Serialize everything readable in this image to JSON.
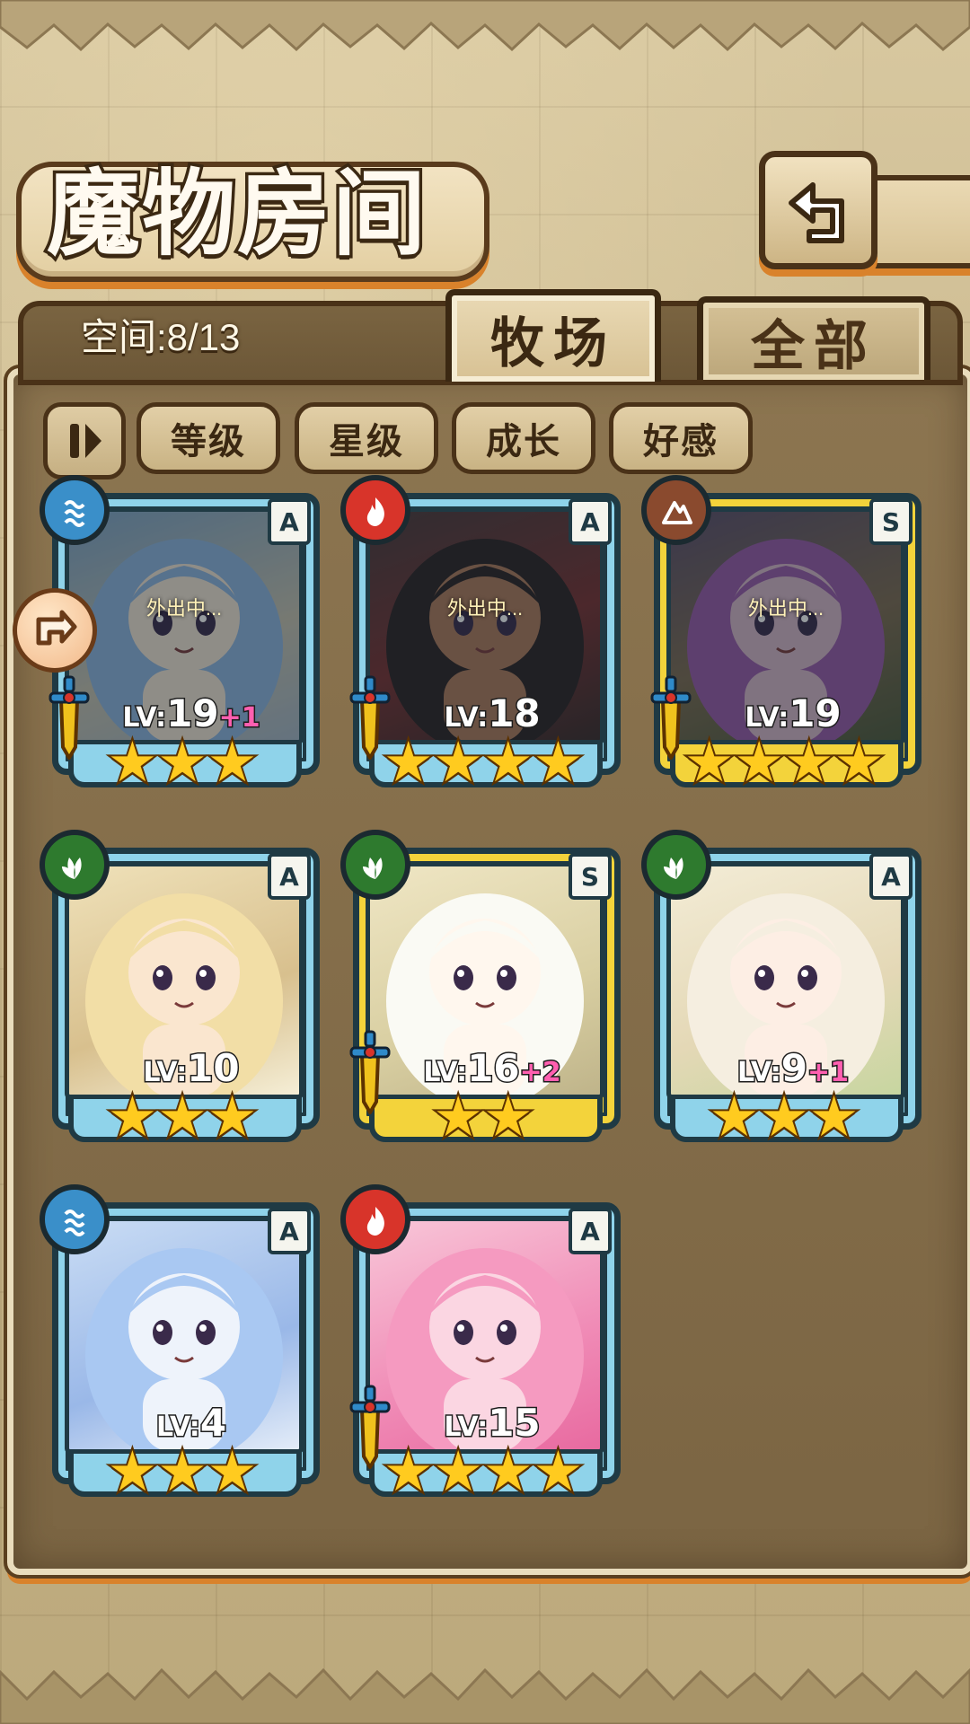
{
  "header": {
    "title": "魔物房间",
    "space_label": "空间:8/13"
  },
  "icons": {
    "back": "back-arrow-icon",
    "pause": "pause-icon",
    "side_token": "arrow-token-icon"
  },
  "tabs": [
    {
      "label": "牧场",
      "active": true
    },
    {
      "label": "全部",
      "active": false
    }
  ],
  "sort_buttons": [
    "等级",
    "星级",
    "成长",
    "好感"
  ],
  "colors": {
    "frame_blue": "#8fd3ea",
    "frame_gold": "#f3d33b",
    "water": "#3a8fc9",
    "fire": "#d8342a",
    "earth": "#8a4a2e",
    "nature": "#2e7a2e",
    "star": "#ffcb1f",
    "bonus": "#ff5fb0"
  },
  "monsters": [
    {
      "level_prefix": "LV:",
      "level": "19",
      "bonus": "+1",
      "rank": "A",
      "element": "water",
      "stars": "★★★",
      "status": "外出中...",
      "frame": "blue",
      "has_sword": true
    },
    {
      "level_prefix": "LV:",
      "level": "18",
      "bonus": "",
      "rank": "A",
      "element": "fire",
      "stars": "★★★★",
      "status": "外出中...",
      "frame": "blue",
      "has_sword": true
    },
    {
      "level_prefix": "LV:",
      "level": "19",
      "bonus": "",
      "rank": "S",
      "element": "earth",
      "stars": "★★★★",
      "status": "外出中...",
      "frame": "gold",
      "has_sword": true
    },
    {
      "level_prefix": "LV:",
      "level": "10",
      "bonus": "",
      "rank": "A",
      "element": "nature",
      "stars": "★★★",
      "status": "",
      "frame": "blue",
      "has_sword": false
    },
    {
      "level_prefix": "LV:",
      "level": "16",
      "bonus": "+2",
      "rank": "S",
      "element": "nature",
      "stars": "★★",
      "status": "",
      "frame": "gold",
      "has_sword": true
    },
    {
      "level_prefix": "LV:",
      "level": "9",
      "bonus": "+1",
      "rank": "A",
      "element": "nature",
      "stars": "★★★",
      "status": "",
      "frame": "blue",
      "has_sword": false
    },
    {
      "level_prefix": "LV:",
      "level": "4",
      "bonus": "",
      "rank": "A",
      "element": "water",
      "stars": "★★★",
      "status": "",
      "frame": "blue",
      "has_sword": false
    },
    {
      "level_prefix": "LV:",
      "level": "15",
      "bonus": "",
      "rank": "A",
      "element": "fire",
      "stars": "★★★★",
      "status": "",
      "frame": "blue",
      "has_sword": true
    }
  ]
}
